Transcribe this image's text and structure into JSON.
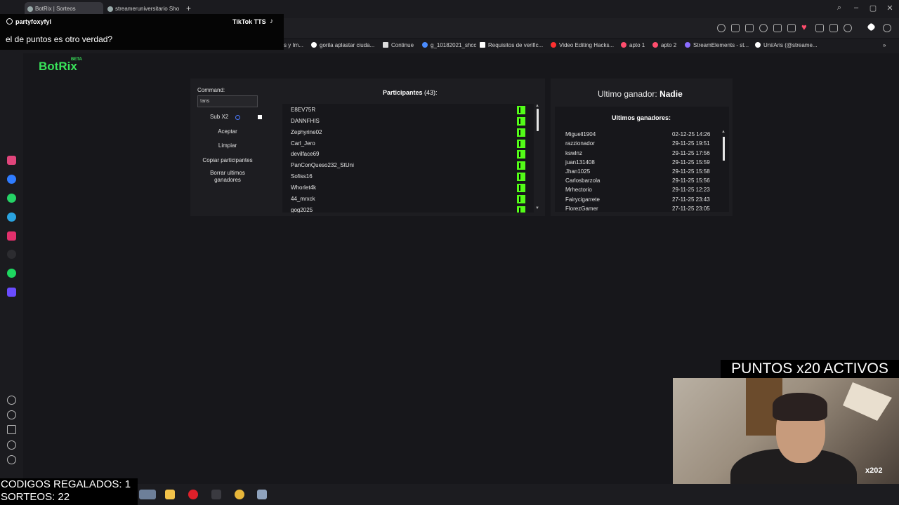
{
  "browser": {
    "tabs": [
      {
        "label": "BotRix | Sorteos",
        "active": true
      },
      {
        "label": "streameruniversitario Sho",
        "active": false
      }
    ],
    "new_tab": "+",
    "bookmarks": [
      {
        "label": "s y Im...",
        "color": ""
      },
      {
        "label": "gorila aplastar ciuda...",
        "color": "#ffffff"
      },
      {
        "label": "Continue",
        "color": "#dddddd"
      },
      {
        "label": "g_10182021_shcc",
        "color": "#4a8cff"
      },
      {
        "label": "Requisitos de verific...",
        "color": "#ffffff"
      },
      {
        "label": "Video Editing Hacks...",
        "color": "#ff3030"
      },
      {
        "label": "apto 1",
        "color": "#ff4d6d"
      },
      {
        "label": "apto 2",
        "color": "#ff4d6d"
      },
      {
        "label": "StreamElements - st...",
        "color": "#8a6cff"
      },
      {
        "label": "Uni/Aris (@streame...",
        "color": "#ffffff"
      }
    ]
  },
  "chat": {
    "user": "partyfoxyfyl",
    "source": "TikTok TTS",
    "message": "el de puntos es otro verdad?"
  },
  "botrix": {
    "logo": "BotRix",
    "beta": "BETA",
    "command_label": "Command:",
    "command_value": "!aris",
    "sub_label": "Sub X2",
    "buttons": {
      "accept": "Aceptar",
      "clear": "Limpiar",
      "copy": "Copiar participantes",
      "delete": "Borrar ultimos ganadores"
    },
    "participants_title": "Participantes",
    "participants_count": "(43):",
    "participants": [
      "E8EV75R",
      "DANNFHIS",
      "Zephyrine02",
      "Carl_Jero",
      "devilface69",
      "PanConQueso232_StUni",
      "Sofiss16",
      "Whorlet4k",
      "44_mrxck",
      "gog2025"
    ],
    "last_winner_label": "Ultimo ganador:",
    "last_winner": "Nadie",
    "winners_title": "Ultimos ganadores:",
    "winners": [
      {
        "name": "Miguell1904",
        "date": "02-12-25 14:26"
      },
      {
        "name": "razzionador",
        "date": "29-11-25 19:51"
      },
      {
        "name": "kswlnz",
        "date": "29-11-25 17:56"
      },
      {
        "name": "juan131408",
        "date": "29-11-25 15:59"
      },
      {
        "name": "Jhan1025",
        "date": "29-11-25 15:58"
      },
      {
        "name": "Carlosbarzola",
        "date": "29-11-25 15:56"
      },
      {
        "name": "Mrhectorio",
        "date": "29-11-25 12:23"
      },
      {
        "name": "Fairycigarrete",
        "date": "27-11-25 23:43"
      },
      {
        "name": "FlorezGamer",
        "date": "27-11-25 23:05"
      }
    ]
  },
  "stream_overlay": {
    "points_banner": "PUNTOS x20 ACTIVOS",
    "codes": "CODIGOS REGALADOS: 1",
    "raffles": "SORTEOS: 22",
    "badge": "x202"
  },
  "colors": {
    "accent": "#39e35a",
    "kick": "#53fc18"
  }
}
